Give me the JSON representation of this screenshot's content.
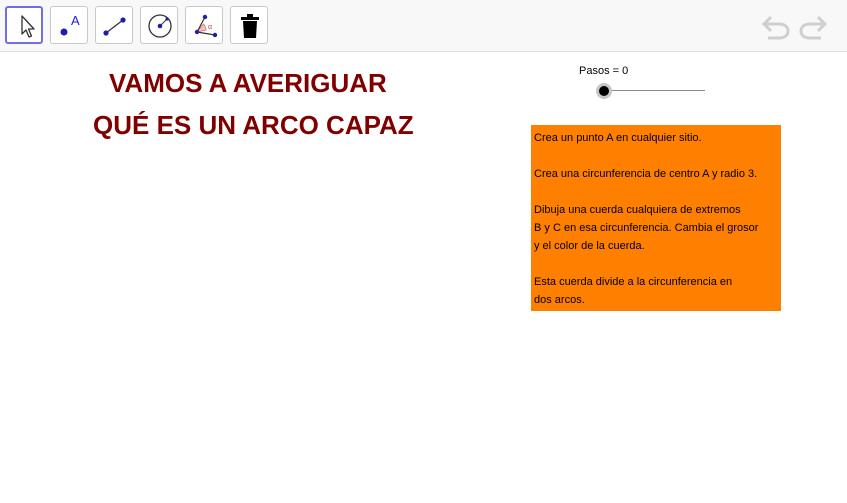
{
  "toolbar": {
    "tools": [
      {
        "name": "move",
        "icon": "move-arrow-icon",
        "selected": true
      },
      {
        "name": "point",
        "icon": "point-icon",
        "label": "A"
      },
      {
        "name": "segment",
        "icon": "segment-icon"
      },
      {
        "name": "circle",
        "icon": "circle-center-point-icon"
      },
      {
        "name": "angle",
        "icon": "angle-icon",
        "label": "α"
      },
      {
        "name": "delete",
        "icon": "trash-icon"
      }
    ],
    "undo_icon": "undo-icon",
    "redo_icon": "redo-icon"
  },
  "canvas": {
    "title_line1": "VAMOS A AVERIGUAR",
    "title_line2": "QUÉ ES UN ARCO CAPAZ",
    "title_color": "#800000",
    "slider": {
      "label": "Pasos = 0",
      "value": 0
    },
    "info_box": {
      "background": "#ff7f00",
      "lines": [
        "Crea un punto A en cualquier sitio.",
        "",
        "Crea una circunferencia de centro A y radio 3.",
        "",
        "Dibuja una cuerda cualquiera de extremos",
        "B y C en esa circunferencia. Cambia el grosor",
        "y el color de la cuerda.",
        "",
        "Esta cuerda divide a la circunferencia en",
        "dos arcos."
      ]
    }
  }
}
